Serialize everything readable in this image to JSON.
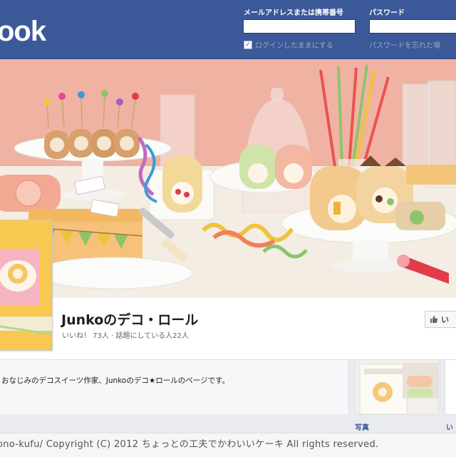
{
  "header": {
    "logo": "ook",
    "email_label": "メールアドレスまたは携帯番号",
    "email_value": "",
    "password_label": "パスワード",
    "password_value": "",
    "remember_label": "ログインしたままにする",
    "forgot_link": "パスワードを忘れた場",
    "brand_color": "#3b5998"
  },
  "page": {
    "name": "Junkoのデコ・ロール",
    "stats": "いいね！ 73人 · 話題にしている人22人",
    "like_button": "い"
  },
  "about": {
    "text": "おなじみのデコスイーツ作家、Junkoのデコ★ロールのページです。"
  },
  "photos": {
    "label": "写真",
    "label2": "い"
  },
  "footer": {
    "text": "ono-kufu/   Copyright (C) 2012   ちょっとの工夫でかわいいケーキ   All rights reserved."
  },
  "icons": {
    "like": "thumbs-up-icon",
    "checkbox": "checkmark-icon"
  }
}
